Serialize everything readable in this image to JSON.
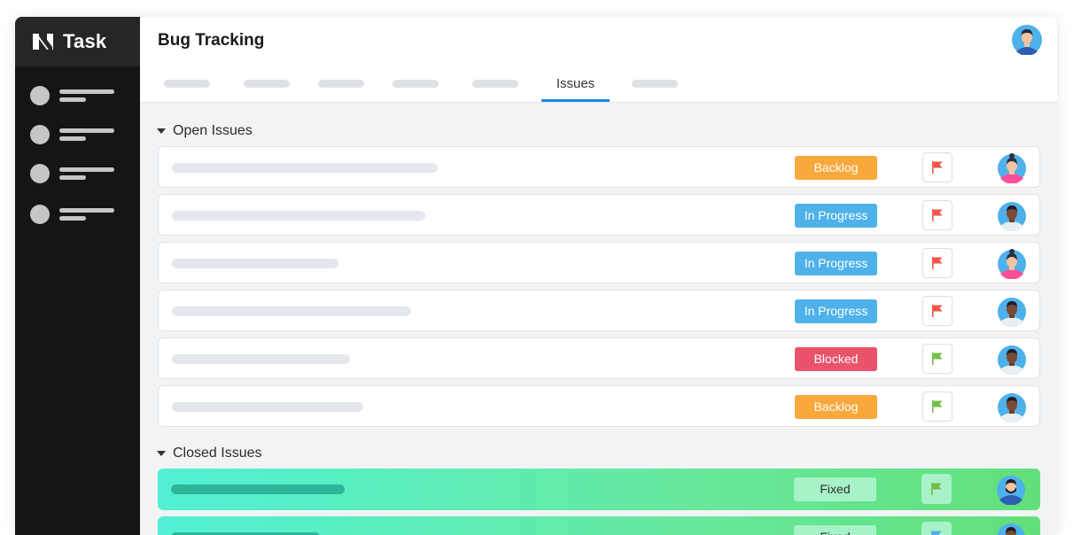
{
  "app": {
    "brand": "Task"
  },
  "header": {
    "title": "Bug Tracking"
  },
  "tabs": {
    "active_label": "Issues"
  },
  "sections": {
    "open_title": "Open Issues",
    "closed_title": "Closed Issues"
  },
  "colors": {
    "backlog": "#f9a83b",
    "in_progress": "#4fb1ea",
    "blocked": "#e9546b",
    "fixed_bg": "#a8f2c9",
    "flag_red": "#f0554b",
    "flag_green": "#76bd45",
    "flag_blue": "#4fb1ea"
  },
  "open_issues": [
    {
      "status": "Backlog",
      "flag": "red-flag-icon",
      "avatar": "female-avatar-icon"
    },
    {
      "status": "In Progress",
      "flag": "red-flag-icon",
      "avatar": "male-avatar-icon"
    },
    {
      "status": "In Progress",
      "flag": "red-flag-icon",
      "avatar": "female-avatar-icon"
    },
    {
      "status": "In Progress",
      "flag": "red-flag-icon",
      "avatar": "male-avatar-icon"
    },
    {
      "status": "Blocked",
      "flag": "green-flag-icon",
      "avatar": "male-avatar-icon"
    },
    {
      "status": "Backlog",
      "flag": "green-flag-icon",
      "avatar": "male-avatar-icon"
    }
  ],
  "closed_issues": [
    {
      "status": "Fixed",
      "flag": "green-flag-icon",
      "avatar": "bearded-avatar-icon"
    },
    {
      "status": "Fixed",
      "flag": "blue-flag-icon",
      "avatar": "male-avatar-icon"
    }
  ]
}
